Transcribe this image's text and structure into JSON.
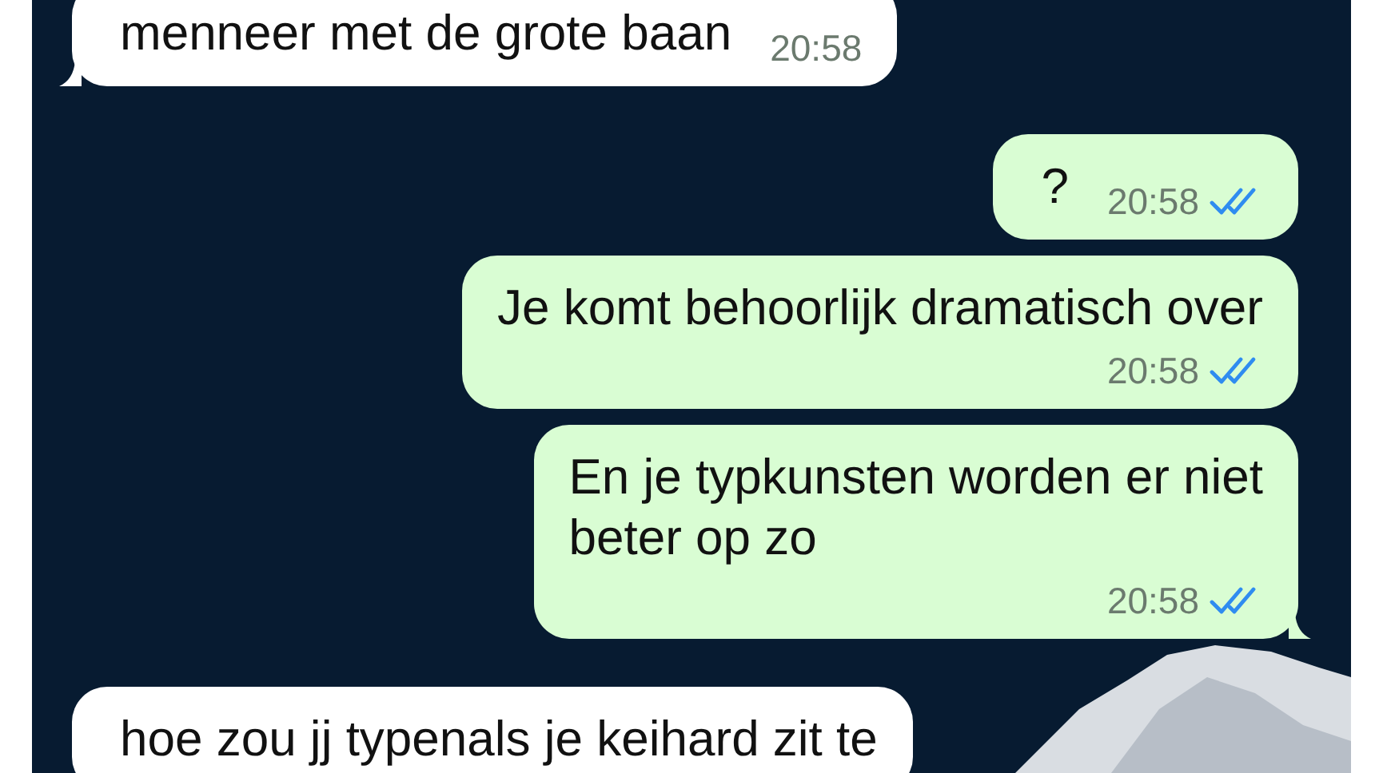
{
  "messages": [
    {
      "kind": "incoming",
      "text": "menneer met de grote baan",
      "time": "20:58",
      "time_below": false,
      "tail": true
    },
    {
      "kind": "outgoing",
      "text": "?",
      "time": "20:58",
      "time_below": false,
      "read": true,
      "tail": false
    },
    {
      "kind": "outgoing",
      "text": "Je komt behoorlijk dramatisch over",
      "time": "20:58",
      "time_below": true,
      "read": true,
      "tail": false
    },
    {
      "kind": "outgoing",
      "text": "En je typkunsten worden er niet\nbeter op zo",
      "time": "20:58",
      "time_below": true,
      "read": true,
      "tail": true
    },
    {
      "kind": "incoming",
      "text": "hoe zou jj typenals je keihard zit te"
    }
  ]
}
